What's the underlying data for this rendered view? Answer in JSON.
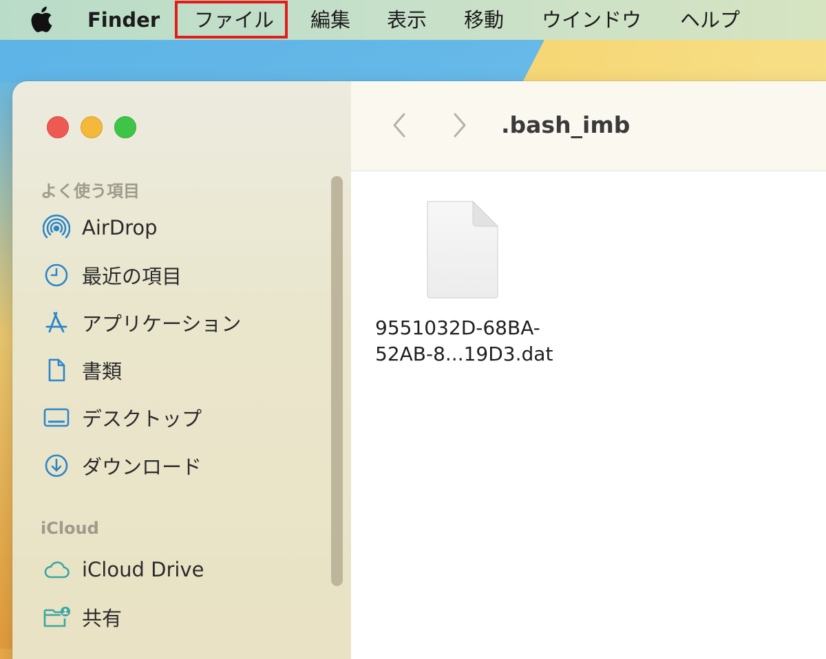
{
  "menubar": {
    "apple_icon": "apple-logo-icon",
    "app_name": "Finder",
    "items": [
      "ファイル",
      "編集",
      "表示",
      "移動",
      "ウインドウ",
      "ヘルプ"
    ],
    "highlight_color": "#e21b1b"
  },
  "window": {
    "controls": {
      "close_color": "#ee5a52",
      "minimize_color": "#f4b83a",
      "zoom_color": "#3ec547"
    },
    "toolbar": {
      "back_icon": "chevron-left-icon",
      "forward_icon": "chevron-right-icon",
      "title": ".bash_imb"
    },
    "sidebar": {
      "favorites_title": "よく使う項目",
      "favorites": [
        {
          "label": "AirDrop",
          "icon": "airdrop-icon"
        },
        {
          "label": "最近の項目",
          "icon": "clock-icon"
        },
        {
          "label": "アプリケーション",
          "icon": "applications-icon"
        },
        {
          "label": "書類",
          "icon": "document-icon"
        },
        {
          "label": "デスクトップ",
          "icon": "desktop-icon"
        },
        {
          "label": "ダウンロード",
          "icon": "download-icon"
        }
      ],
      "icloud_title": "iCloud",
      "icloud": [
        {
          "label": "iCloud Drive",
          "icon": "cloud-icon"
        },
        {
          "label": "共有",
          "icon": "shared-folder-icon"
        }
      ],
      "icon_color": "#2a86c8"
    },
    "files": [
      {
        "name_line1": "9551032D-68BA-",
        "name_line2": "52AB-8...19D3.dat",
        "icon": "generic-file-icon"
      }
    ]
  }
}
